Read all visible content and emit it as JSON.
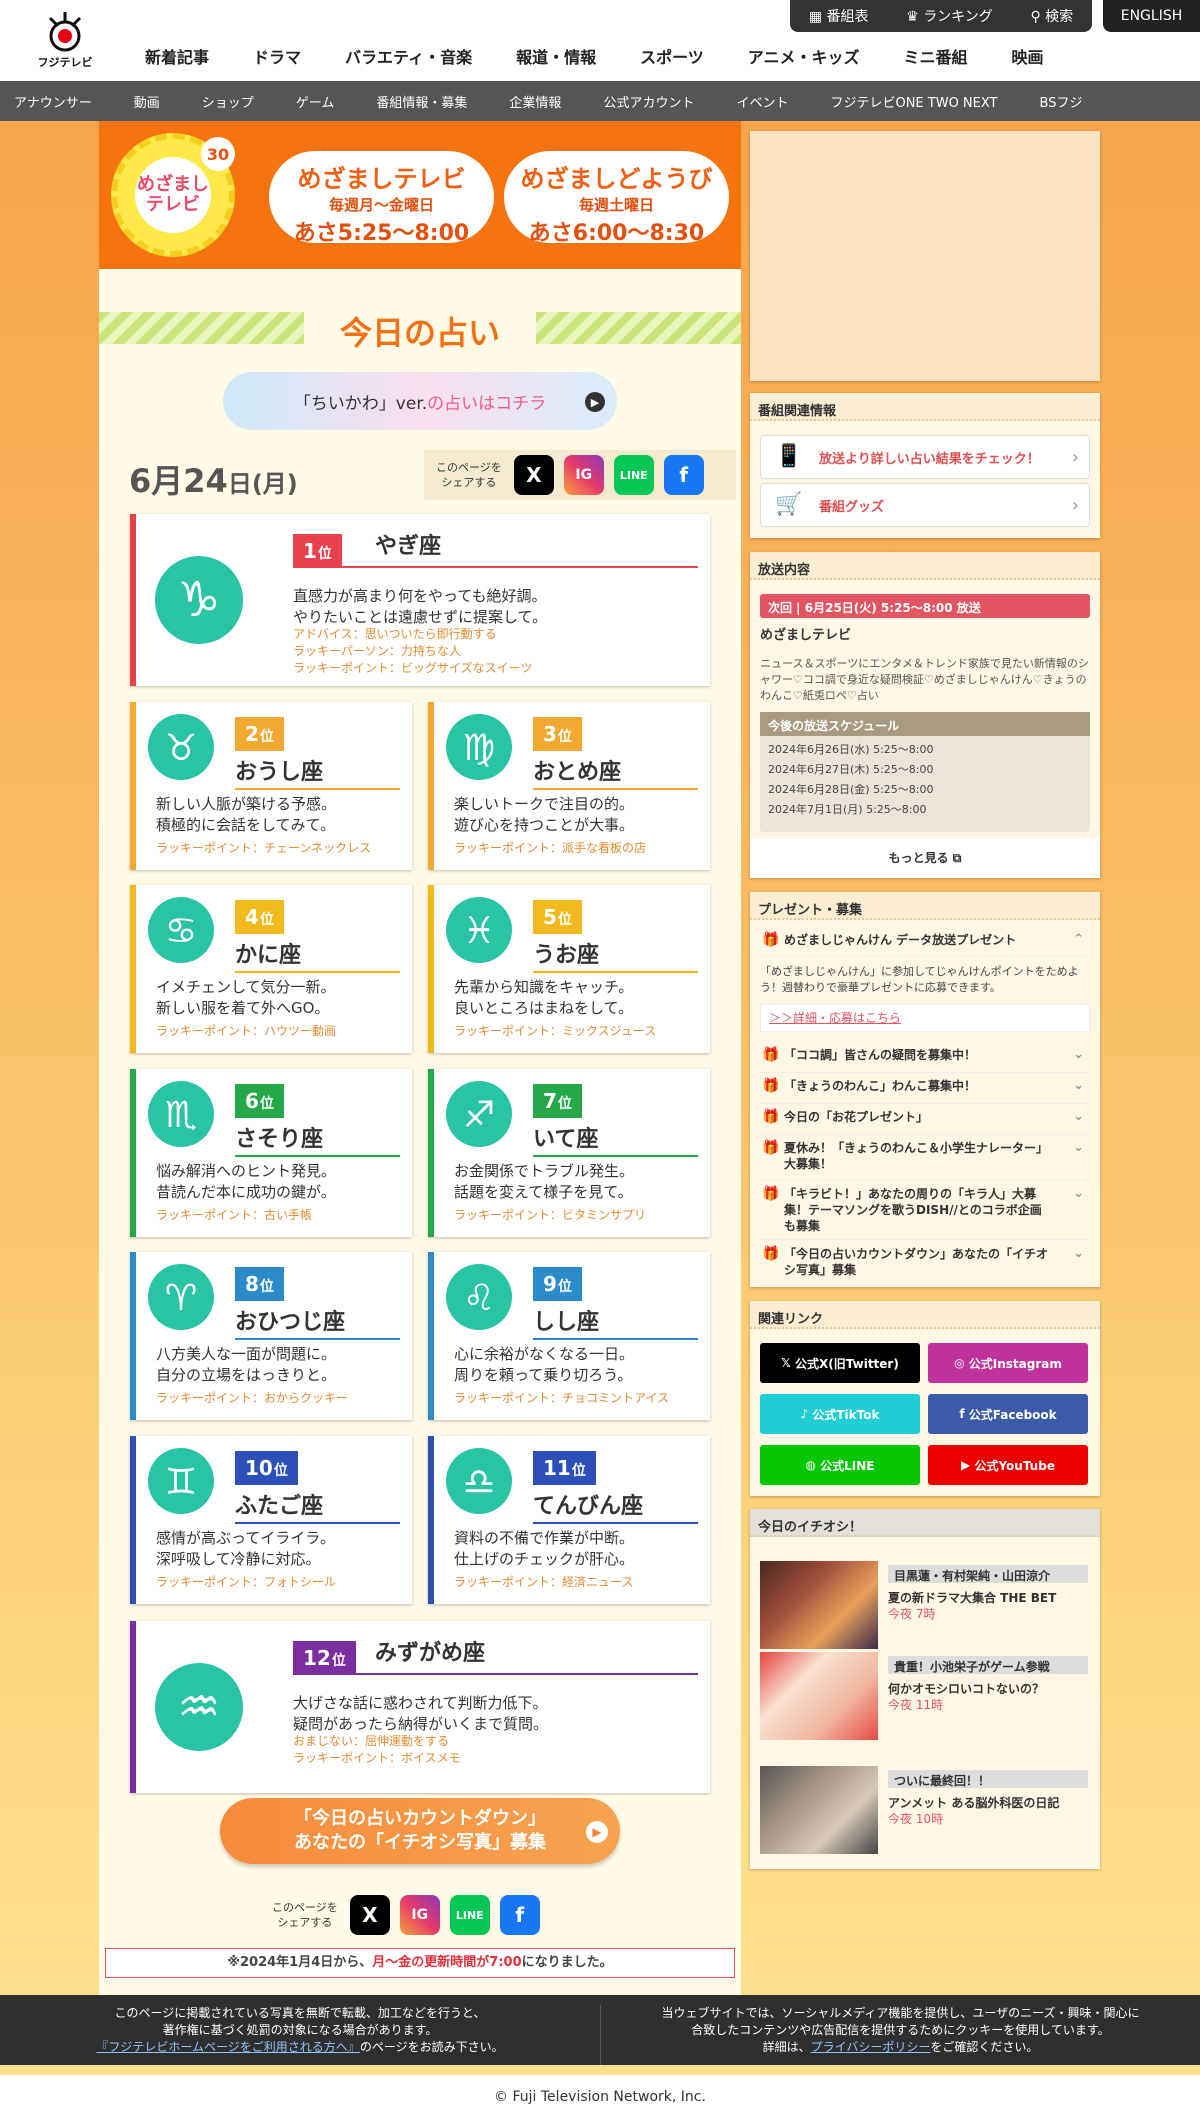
{
  "header": {
    "logo_text": "フジテレビ",
    "nav": [
      "新着記事",
      "ドラマ",
      "バラエティ・音楽",
      "報道・情報",
      "スポーツ",
      "アニメ・キッズ",
      "ミニ番組",
      "映画"
    ],
    "util": [
      "番組表",
      "ランキング",
      "検索"
    ],
    "english": "ENGLISH",
    "subnav": [
      "アナウンサー",
      "動画",
      "ショップ",
      "ゲーム",
      "番組情報・募集",
      "企業情報",
      "公式アカウント",
      "イベント",
      "フジテレビONE TWO NEXT",
      "BSフジ"
    ]
  },
  "banner": {
    "logo": "めざましテレビ",
    "anniv": "30",
    "p1": {
      "title": "めざましテレビ",
      "days": "毎週月〜金曜日",
      "time": "あさ5:25〜8:00"
    },
    "p2": {
      "title": "めざましどようび",
      "days": "毎週土曜日",
      "time": "あさ6:00〜8:30"
    }
  },
  "page": {
    "title": "今日の占い",
    "chiikawa_a": "「ちいかわ」ver.",
    "chiikawa_b": "の占いはコチラ",
    "date_md": "6月24",
    "date_day": "日",
    "date_wd": "(月)",
    "share_label_1": "このページを",
    "share_label_2": "シェアする",
    "countdown_1": "「今日の占いカウントダウン」",
    "countdown_2": "あなたの「イチオシ写真」募集",
    "notice_a": "※2024年1月4日から、",
    "notice_b": "月〜金の更新時間が7:00",
    "notice_c": "になりました。"
  },
  "share_icons": [
    "X",
    "IG",
    "LINE",
    "f"
  ],
  "fortunes": [
    {
      "rank": "1",
      "unit": "位",
      "sign": "やぎ座",
      "symbol": "♑",
      "msg1": "直感力が高まり何をやっても絶好調。",
      "msg2": "やりたいことは遠慮せずに提案して。",
      "extra": [
        "アドバイス：思いついたら即行動する",
        "ラッキーパーソン：力持ちな人",
        "ラッキーポイント：ビッグサイズなスイーツ"
      ],
      "color": "#e8414d"
    },
    {
      "rank": "2",
      "unit": "位",
      "sign": "おうし座",
      "symbol": "♉",
      "msg1": "新しい人脈が築ける予感。",
      "msg2": "積極的に会話をしてみて。",
      "extra": [
        "ラッキーポイント：チェーンネックレス"
      ],
      "color": "#f2a932"
    },
    {
      "rank": "3",
      "unit": "位",
      "sign": "おとめ座",
      "symbol": "♍",
      "msg1": "楽しいトークで注目の的。",
      "msg2": "遊び心を持つことが大事。",
      "extra": [
        "ラッキーポイント：派手な看板の店"
      ],
      "color": "#f2a932"
    },
    {
      "rank": "4",
      "unit": "位",
      "sign": "かに座",
      "symbol": "♋",
      "msg1": "イメチェンして気分一新。",
      "msg2": "新しい服を着て外へGO。",
      "extra": [
        "ラッキーポイント：ハウツー動画"
      ],
      "color": "#f2b91c"
    },
    {
      "rank": "5",
      "unit": "位",
      "sign": "うお座",
      "symbol": "♓",
      "msg1": "先輩から知識をキャッチ。",
      "msg2": "良いところはまねをして。",
      "extra": [
        "ラッキーポイント：ミックスジュース"
      ],
      "color": "#f2b91c"
    },
    {
      "rank": "6",
      "unit": "位",
      "sign": "さそり座",
      "symbol": "♏",
      "msg1": "悩み解消へのヒント発見。",
      "msg2": "昔読んだ本に成功の鍵が。",
      "extra": [
        "ラッキーポイント：古い手帳"
      ],
      "color": "#25a84a"
    },
    {
      "rank": "7",
      "unit": "位",
      "sign": "いて座",
      "symbol": "♐",
      "msg1": "お金関係でトラブル発生。",
      "msg2": "話題を変えて様子を見て。",
      "extra": [
        "ラッキーポイント：ビタミンサプリ"
      ],
      "color": "#25a84a"
    },
    {
      "rank": "8",
      "unit": "位",
      "sign": "おひつじ座",
      "symbol": "♈",
      "msg1": "八方美人な一面が問題に。",
      "msg2": "自分の立場をはっきりと。",
      "extra": [
        "ラッキーポイント：おからクッキー"
      ],
      "color": "#2b8cc9"
    },
    {
      "rank": "9",
      "unit": "位",
      "sign": "しし座",
      "symbol": "♌",
      "msg1": "心に余裕がなくなる一日。",
      "msg2": "周りを頼って乗り切ろう。",
      "extra": [
        "ラッキーポイント：チョコミントアイス"
      ],
      "color": "#2b8cc9"
    },
    {
      "rank": "10",
      "unit": "位",
      "sign": "ふたご座",
      "symbol": "♊",
      "msg1": "感情が高ぶってイライラ。",
      "msg2": "深呼吸して冷静に対応。",
      "extra": [
        "ラッキーポイント：フォトシール"
      ],
      "color": "#2c4fb8"
    },
    {
      "rank": "11",
      "unit": "位",
      "sign": "てんびん座",
      "symbol": "♎",
      "msg1": "資料の不備で作業が中断。",
      "msg2": "仕上げのチェックが肝心。",
      "extra": [
        "ラッキーポイント：経済ニュース"
      ],
      "color": "#2c4fb8"
    },
    {
      "rank": "12",
      "unit": "位",
      "sign": "みずがめ座",
      "symbol": "♒",
      "msg1": "大げさな話に惑わされて判断力低下。",
      "msg2": "疑問があったら納得がいくまで質問。",
      "extra": [
        "おまじない：屈伸運動をする",
        "ラッキーポイント：ボイスメモ"
      ],
      "color": "#7b2e9e"
    }
  ],
  "sidebar": {
    "related_title": "番組関連情報",
    "related": [
      "放送より詳しい占い結果をチェック！",
      "番組グッズ"
    ],
    "broadcast_title": "放送内容",
    "next": "次回 | 6月25日(火) 5:25〜8:00 放送",
    "prog": "めざましテレビ",
    "desc": "ニュース＆スポーツにエンタメ＆トレンド家族で見たい新情報のシャワー♡ココ調で身近な疑問検証♡めざましじゃんけん♡きょうのわんこ♡紙兎ロペ♡占い",
    "sched_title": "今後の放送スケジュール",
    "sched": [
      "2024年6月26日(水) 5:25〜8:00",
      "2024年6月27日(木) 5:25〜8:00",
      "2024年6月28日(金) 5:25〜8:00",
      "2024年7月1日(月) 5:25〜8:00"
    ],
    "more": "もっと見る",
    "present_title": "プレゼント・募集",
    "present_open": "めざましじゃんけん データ放送プレゼント",
    "present_desc": "「めざましじゃんけん」に参加してじゃんけんポイントをためよう！週替わりで豪華プレゼントに応募できます。",
    "present_link": "＞＞詳細・応募はこちら",
    "present_items": [
      "「ココ調」皆さんの疑問を募集中！",
      "「きょうのわんこ」わんこ募集中！",
      "今日の「お花プレゼント」",
      "夏休み！「きょうのわんこ＆小学生ナレーター」大募集！",
      "「キラビト！」あなたの周りの「キラ人」大募集！テーマソングを歌うDISH//とのコラボ企画も募集",
      "「今日の占いカウントダウン」あなたの「イチオシ写真」募集"
    ],
    "links_title": "関連リンク",
    "links": [
      "公式X(旧Twitter)",
      "公式Instagram",
      "公式TikTok",
      "公式Facebook",
      "公式LINE",
      "公式YouTube"
    ],
    "ichioshi_title": "今日のイチオシ！",
    "ichioshi": [
      {
        "tag": "目黒蓮・有村架純・山田涼介",
        "title": "夏の新ドラマ大集合 THE BET",
        "time": "今夜 7時"
      },
      {
        "tag": "貴重！小池栄子がゲーム参戦",
        "title": "何かオモシロいコトないの？",
        "time": "今夜 11時"
      },
      {
        "tag": "ついに最終回！！",
        "title": "アンメット ある脳外科医の日記",
        "time": "今夜 10時"
      }
    ]
  },
  "footer": {
    "l1": "このページに掲載されている写真を無断で転載、加工などを行うと、",
    "l2": "著作権に基づく処罰の対象になる場合があります。",
    "l3a": "『フジテレビホームページをご利用される方へ』",
    "l3b": "のページをお読み下さい。",
    "r1": "当ウェブサイトでは、ソーシャルメディア機能を提供し、ユーザのニーズ・興味・関心に",
    "r2": "合致したコンテンツや広告配信を提供するためにクッキーを使用しています。",
    "r3a": "詳細は、",
    "r3b": "プライバシーポリシー",
    "r3c": "をご確認ください。",
    "copy": "© Fuji Television Network, Inc."
  }
}
